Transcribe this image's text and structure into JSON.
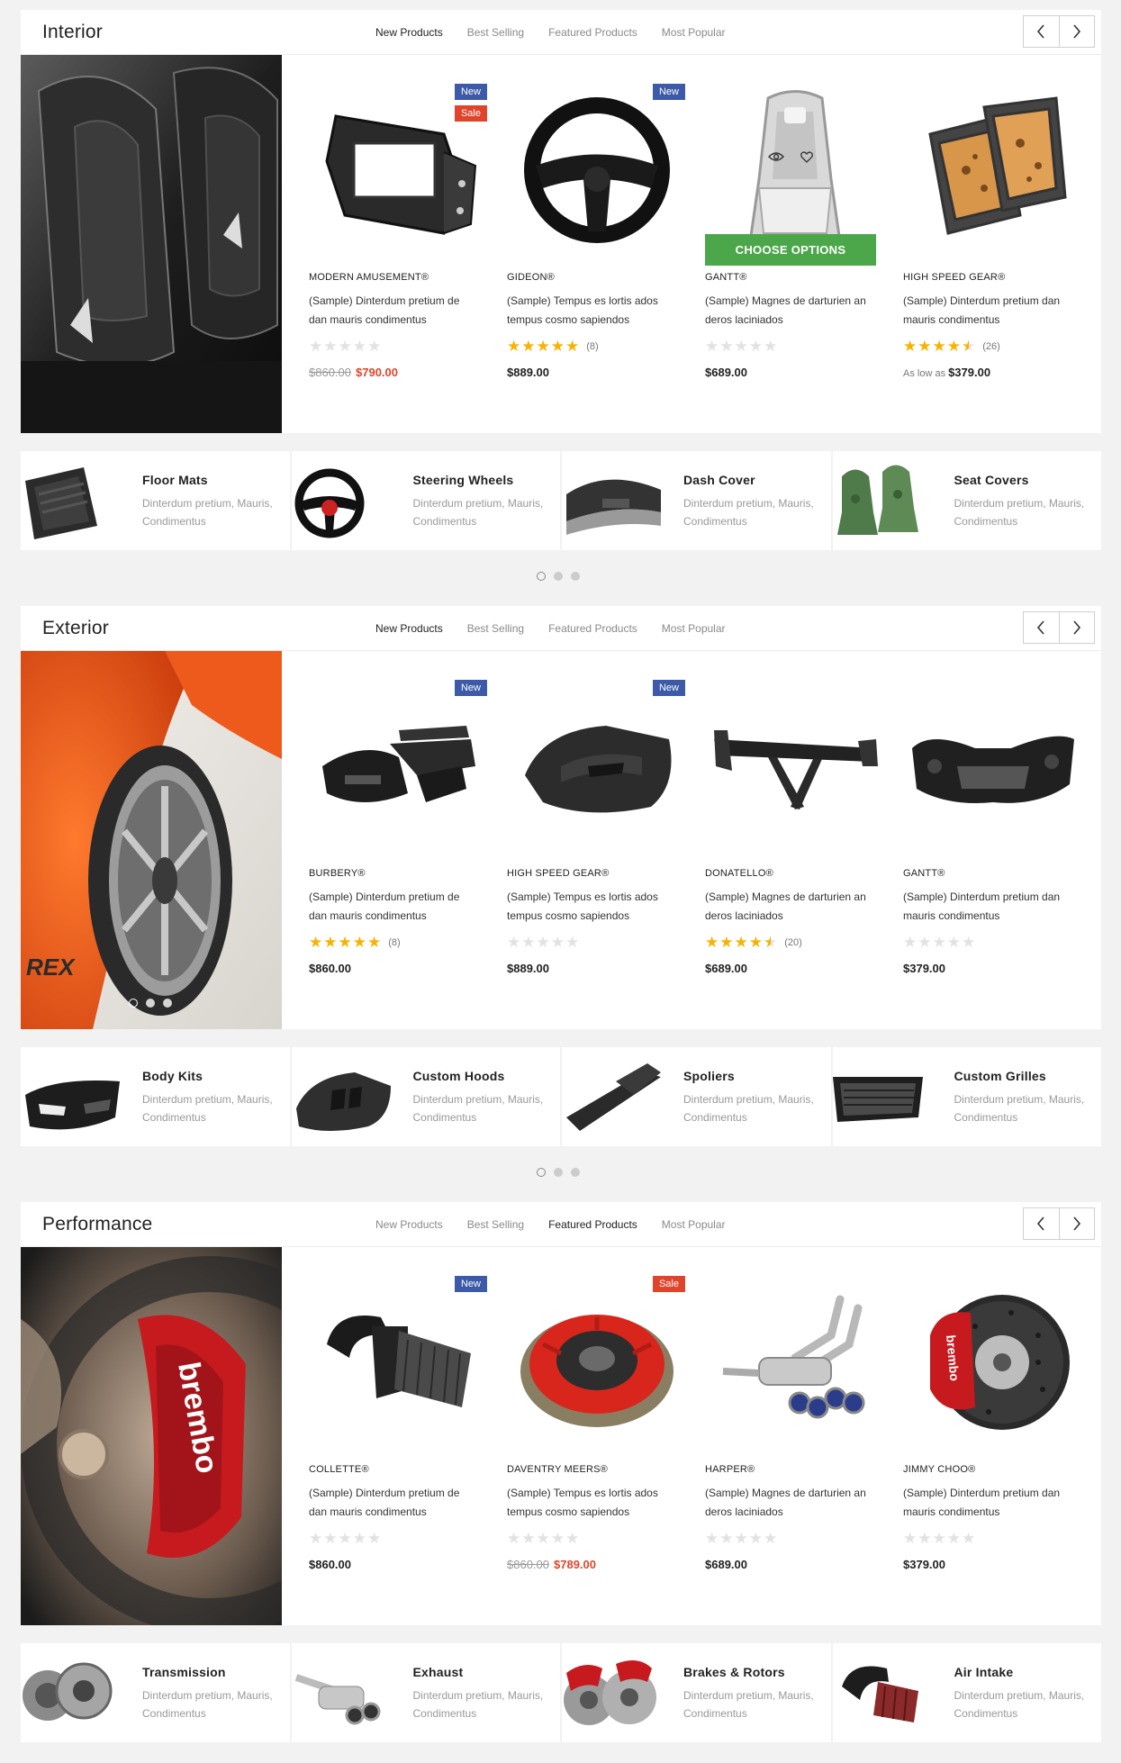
{
  "nav": {
    "prev_icon": "chevron-left-icon",
    "next_icon": "chevron-right-icon"
  },
  "colors": {
    "new_badge": "#3c5aa8",
    "sale_badge": "#e0442a",
    "star": "#f5b400",
    "choose_button": "#4ca64a"
  },
  "sections": [
    {
      "title": "Interior",
      "tabs": [
        "New Products",
        "Best Selling",
        "Featured Products",
        "Most Popular"
      ],
      "active_tab": "New Products",
      "products": [
        {
          "brand": "MODERN AMUSEMENT®",
          "desc": "(Sample) Dinterdum pretium de dan mauris condimentus",
          "badges": [
            "New",
            "Sale"
          ],
          "rating": 0,
          "reviews": "",
          "price_old": "$860.00",
          "price": "$790.00",
          "image": "radio-dash-kit-bracket"
        },
        {
          "brand": "GIDEON®",
          "desc": "(Sample) Tempus es lortis ados tempus cosmo sapiendos",
          "badges": [
            "New"
          ],
          "rating": 5,
          "reviews": "(8)",
          "price_old": "",
          "price": "$889.00",
          "image": "steering-wheel"
        },
        {
          "brand": "GANTT®",
          "desc": "(Sample) Magnes de darturien an deros laciniados",
          "badges": [],
          "rating": 0,
          "reviews": "",
          "price_old": "",
          "price": "$689.00",
          "image": "racing-seat",
          "button": "CHOOSE OPTIONS"
        },
        {
          "brand": "HIGH SPEED GEAR®",
          "desc": "(Sample) Dinterdum pretium dan mauris condimentus",
          "badges": [],
          "rating": 4.5,
          "reviews": "(26)",
          "price_prefix": "As low as",
          "price_old": "",
          "price": "$379.00",
          "image": "floor-mats"
        }
      ],
      "categories": [
        {
          "name": "Floor Mats",
          "desc": "Dinterdum pretium, Mauris, Condimentus"
        },
        {
          "name": "Steering Wheels",
          "desc": "Dinterdum pretium, Mauris, Condimentus"
        },
        {
          "name": "Dash Cover",
          "desc": "Dinterdum pretium, Mauris, Condimentus"
        },
        {
          "name": "Seat Covers",
          "desc": "Dinterdum pretium, Mauris, Condimentus"
        }
      ]
    },
    {
      "title": "Exterior",
      "tabs": [
        "New Products",
        "Best Selling",
        "Featured Products",
        "Most Popular"
      ],
      "active_tab": "New Products",
      "products": [
        {
          "brand": "BURBERY®",
          "desc": "(Sample) Dinterdum pretium de dan mauris condimentus",
          "badges": [
            "New"
          ],
          "rating": 5,
          "reviews": "(8)",
          "price_old": "",
          "price": "$860.00",
          "image": "body-kit"
        },
        {
          "brand": "HIGH SPEED GEAR®",
          "desc": "(Sample) Tempus es lortis ados tempus cosmo sapiendos",
          "badges": [
            "New"
          ],
          "rating": 0,
          "reviews": "",
          "price_old": "",
          "price": "$889.00",
          "image": "carbon-hood"
        },
        {
          "brand": "DONATELLO®",
          "desc": "(Sample) Magnes de darturien an deros laciniados",
          "badges": [],
          "rating": 4.5,
          "reviews": "(20)",
          "price_old": "",
          "price": "$689.00",
          "image": "rear-wing-spoiler"
        },
        {
          "brand": "GANTT®",
          "desc": "(Sample) Dinterdum pretium dan mauris condimentus",
          "badges": [],
          "rating": 0,
          "reviews": "",
          "price_old": "",
          "price": "$379.00",
          "image": "front-bumper"
        }
      ],
      "categories": [
        {
          "name": "Body Kits",
          "desc": "Dinterdum pretium, Mauris, Condimentus"
        },
        {
          "name": "Custom Hoods",
          "desc": "Dinterdum pretium, Mauris, Condimentus"
        },
        {
          "name": "Spoliers",
          "desc": "Dinterdum pretium, Mauris, Condimentus"
        },
        {
          "name": "Custom Grilles",
          "desc": "Dinterdum pretium, Mauris, Condimentus"
        }
      ]
    },
    {
      "title": "Performance",
      "tabs": [
        "New Products",
        "Best Selling",
        "Featured Products",
        "Most Popular"
      ],
      "active_tab": "Featured Products",
      "products": [
        {
          "brand": "COLLETTE®",
          "desc": "(Sample) Dinterdum pretium de dan mauris condimentus",
          "badges": [
            "New"
          ],
          "rating": 0,
          "reviews": "",
          "price_old": "",
          "price": "$860.00",
          "image": "cold-air-intake"
        },
        {
          "brand": "DAVENTRY MEERS®",
          "desc": "(Sample) Tempus es lortis ados tempus cosmo sapiendos",
          "badges": [
            "Sale"
          ],
          "rating": 0,
          "reviews": "",
          "price_old": "$860.00",
          "price": "$789.00",
          "image": "clutch-kit"
        },
        {
          "brand": "HARPER®",
          "desc": "(Sample) Magnes de darturien an deros laciniados",
          "badges": [],
          "rating": 0,
          "reviews": "",
          "price_old": "",
          "price": "$689.00",
          "image": "exhaust-system"
        },
        {
          "brand": "JIMMY CHOO®",
          "desc": "(Sample) Dinterdum pretium dan mauris condimentus",
          "badges": [],
          "rating": 0,
          "reviews": "",
          "price_old": "",
          "price": "$379.00",
          "image": "brake-rotor"
        }
      ],
      "categories": [
        {
          "name": "Transmission",
          "desc": "Dinterdum pretium, Mauris, Condimentus"
        },
        {
          "name": "Exhaust",
          "desc": "Dinterdum pretium, Mauris, Condimentus"
        },
        {
          "name": "Brakes & Rotors",
          "desc": "Dinterdum pretium, Mauris, Condimentus"
        },
        {
          "name": "Air Intake",
          "desc": "Dinterdum pretium, Mauris, Condimentus"
        }
      ]
    }
  ]
}
